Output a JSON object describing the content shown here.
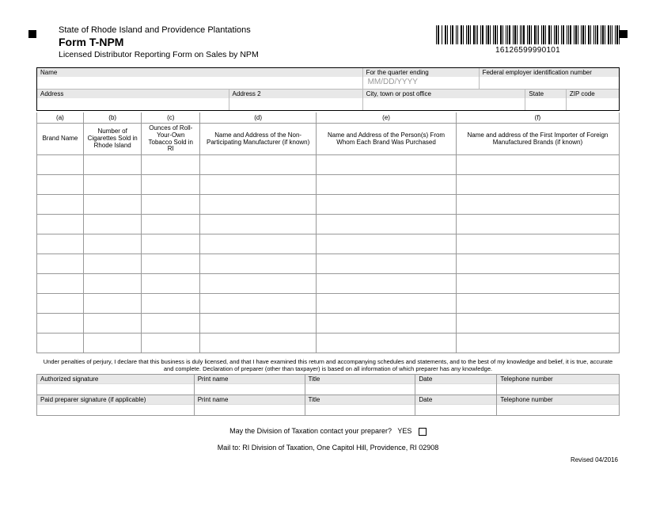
{
  "header": {
    "state": "State of Rhode Island and Providence Plantations",
    "form": "Form T-NPM",
    "subtitle": "Licensed Distributor Reporting Form on Sales by NPM",
    "barcode_number": "16126599990101"
  },
  "top": {
    "name_label": "Name",
    "quarter_label": "For the quarter ending",
    "quarter_placeholder": "MM/DD/YYYY",
    "fein_label": "Federal employer identification number",
    "address_label": "Address",
    "address2_label": "Address 2",
    "city_label": "City, town or post office",
    "state_label": "State",
    "zip_label": "ZIP code"
  },
  "cols": {
    "a": "(a)",
    "b": "(b)",
    "c": "(c)",
    "d": "(d)",
    "e": "(e)",
    "f": "(f)",
    "ha": "Brand Name",
    "hb": "Number of Cigarettes Sold in Rhode Island",
    "hc": "Ounces of Roll-Your-Own Tobacco Sold in RI",
    "hd": "Name and Address of the Non-Participating Manufacturer (if known)",
    "he": "Name and Address of the Person(s) From Whom Each Brand Was Purchased",
    "hf": "Name and address of the First Importer of Foreign Manufactured Brands (if known)"
  },
  "perjury": "Under penalties of perjury, I declare that this business is duly licensed, and that I have examined this return and accompanying schedules and statements, and to the best of my knowledge and belief, it is true, accurate and complete. Declaration of preparer (other than taxpayer) is based on all information of which preparer has any knowledge.",
  "sig": {
    "auth": "Authorized signature",
    "print": "Print name",
    "title": "Title",
    "date": "Date",
    "phone": "Telephone number",
    "paid": "Paid preparer signature (if applicable)"
  },
  "footer": {
    "contact": "May the Division of Taxation contact your preparer?",
    "yes": "YES",
    "mailto": "Mail to: RI Division of Taxation, One Capitol Hill, Providence, RI 02908",
    "revised": "Revised 04/2016"
  }
}
